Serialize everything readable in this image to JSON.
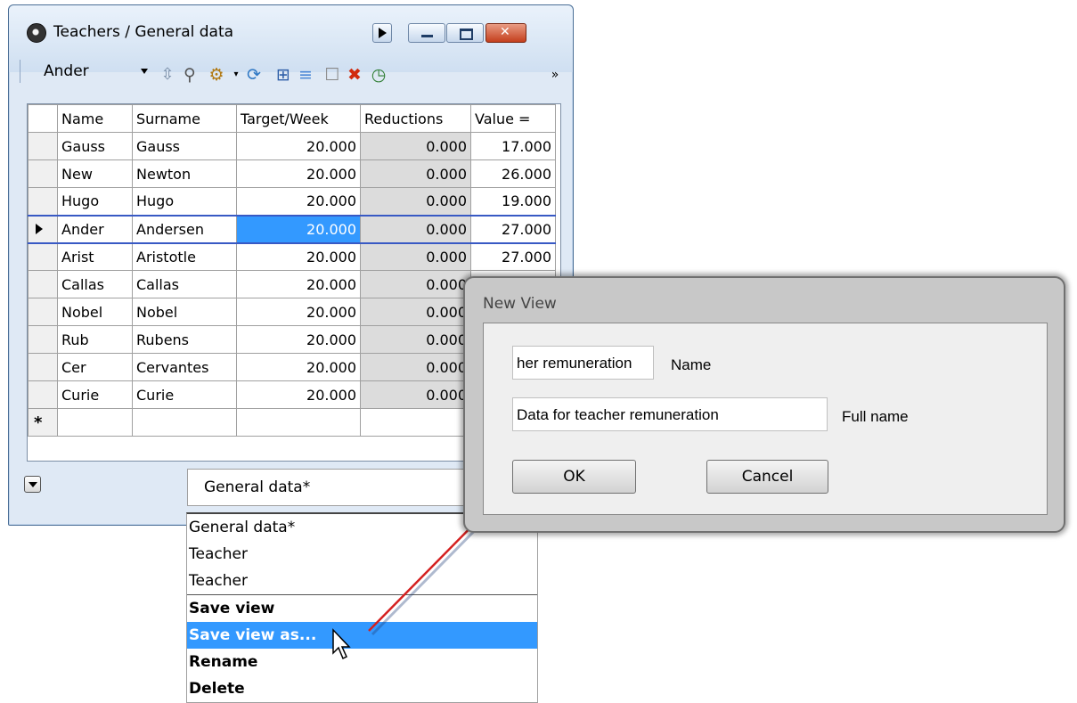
{
  "window": {
    "title": "Teachers / General data",
    "toolbar_combo_value": "Ander",
    "more_glyph": "»"
  },
  "grid": {
    "columns": [
      "Name",
      "Surname",
      "Target/Week",
      "Reductions",
      "Value ="
    ],
    "rows": [
      {
        "name": "Gauss",
        "surname": "Gauss",
        "target": "20.000",
        "reductions": "0.000",
        "value": "17.000"
      },
      {
        "name": "New",
        "surname": "Newton",
        "target": "20.000",
        "reductions": "0.000",
        "value": "26.000"
      },
      {
        "name": "Hugo",
        "surname": "Hugo",
        "target": "20.000",
        "reductions": "0.000",
        "value": "19.000"
      },
      {
        "name": "Ander",
        "surname": "Andersen",
        "target": "20.000",
        "reductions": "0.000",
        "value": "27.000"
      },
      {
        "name": "Arist",
        "surname": "Aristotle",
        "target": "20.000",
        "reductions": "0.000",
        "value": "27.000"
      },
      {
        "name": "Callas",
        "surname": "Callas",
        "target": "20.000",
        "reductions": "0.000",
        "value": ""
      },
      {
        "name": "Nobel",
        "surname": "Nobel",
        "target": "20.000",
        "reductions": "0.000",
        "value": ""
      },
      {
        "name": "Rub",
        "surname": "Rubens",
        "target": "20.000",
        "reductions": "0.000",
        "value": ""
      },
      {
        "name": "Cer",
        "surname": "Cervantes",
        "target": "20.000",
        "reductions": "0.000",
        "value": ""
      },
      {
        "name": "Curie",
        "surname": "Curie",
        "target": "20.000",
        "reductions": "0.000",
        "value": ""
      }
    ],
    "current_row_index": 3,
    "new_row_marker": "*"
  },
  "view_selector": {
    "value": "General data*",
    "options": [
      "General data*",
      "Teacher",
      "Teacher"
    ],
    "actions": [
      "Save view",
      "Save view as...",
      "Rename",
      "Delete"
    ],
    "highlighted": "Save view as..."
  },
  "dialog": {
    "title": "New View",
    "name_value": "her remuneration",
    "name_label": "Name",
    "full_name_value": "Data for teacher remuneration",
    "full_name_label": "Full name",
    "ok_label": "OK",
    "cancel_label": "Cancel"
  },
  "colors": {
    "selection": "#3399ff",
    "arrow": "#d42020"
  }
}
